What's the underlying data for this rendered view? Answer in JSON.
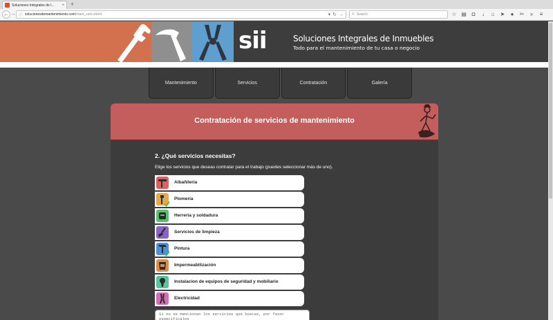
{
  "browser": {
    "tab_title": "Soluciones Integrales de I...",
    "tab_close": "×",
    "new_tab": "+",
    "url_host": "solucionesdemantenimiento.com",
    "url_path": "/mant_cont.shtml",
    "search_placeholder": "Search",
    "icons": [
      "star-icon",
      "reader-icon",
      "pocket-icon",
      "download-icon",
      "home-icon",
      "send-icon",
      "chat-icon",
      "screenshot-icon",
      "overflow-icon",
      "menu-icon"
    ]
  },
  "site": {
    "logo_text": "sii",
    "brand_title": "Soluciones Integrales de Inmuebles",
    "brand_subtitle": "Todo para el mantenimiento de tu casa o negocio",
    "nav": [
      "Mantenimiento",
      "Servicios",
      "Contratación",
      "Galería"
    ]
  },
  "card": {
    "title": "Contratación de servicios de mantenimiento",
    "question": "2. ¿Qué servicios necesitas?",
    "instructions": "Elige los servicios que deseas contratar para el trabajo (puedes seleccionar más de uno).",
    "services": [
      {
        "label": "Albañilería",
        "icon": "trowel-icon",
        "color": "#e0605c",
        "checked": false
      },
      {
        "label": "Plomería",
        "icon": "wrench-icon",
        "color": "#e6a94a",
        "checked": true
      },
      {
        "label": "Herrería y soldadura",
        "icon": "welding-mask-icon",
        "color": "#57c26a",
        "checked": false
      },
      {
        "label": "Servicios de limpieza",
        "icon": "broom-icon",
        "color": "#8a63c9",
        "checked": false
      },
      {
        "label": "Pintura",
        "icon": "paint-roller-icon",
        "color": "#4f8fd6",
        "checked": true
      },
      {
        "label": "Impermeabilización",
        "icon": "bucket-icon",
        "color": "#e48c45",
        "checked": false
      },
      {
        "label": "Instalacion de equipos de seguridad y mobiliario",
        "icon": "drill-icon",
        "color": "#56c49c",
        "checked": false
      },
      {
        "label": "Electricidad",
        "icon": "pliers-icon",
        "color": "#d86bb8",
        "checked": false
      }
    ],
    "comments_placeholder": "Si no se mencionan los servicios que buscas, por favor especifícalos"
  }
}
